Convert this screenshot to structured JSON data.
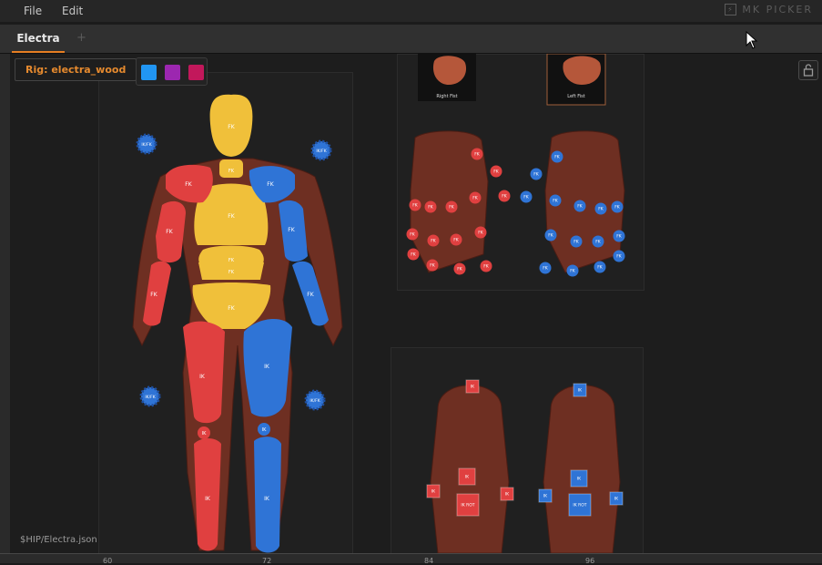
{
  "menu": {
    "file": "File",
    "edit": "Edit",
    "brand": "MK PICKER"
  },
  "tabs": [
    {
      "label": "Electra"
    }
  ],
  "tab_add": "+",
  "rig_label": "Rig: electra_wood",
  "swatch_colors": [
    "#2196f3",
    "#9c27b0",
    "#c2185b"
  ],
  "path_label": "$HIP/Electra.json",
  "body_picker": {
    "colors": {
      "center": "#f0c03a",
      "left": "#e04040",
      "right": "#2f74d6"
    },
    "fk": "FK",
    "ik": "IK",
    "ikfk": "IK/FK"
  },
  "hands": {
    "right_fist": "Right Fist",
    "left_fist": "Left Fist",
    "fk": "FK"
  },
  "feet": {
    "ik": "IK",
    "ik_rot": "IK ROT"
  },
  "ruler_ticks": [
    "60",
    "72",
    "84",
    "96"
  ]
}
